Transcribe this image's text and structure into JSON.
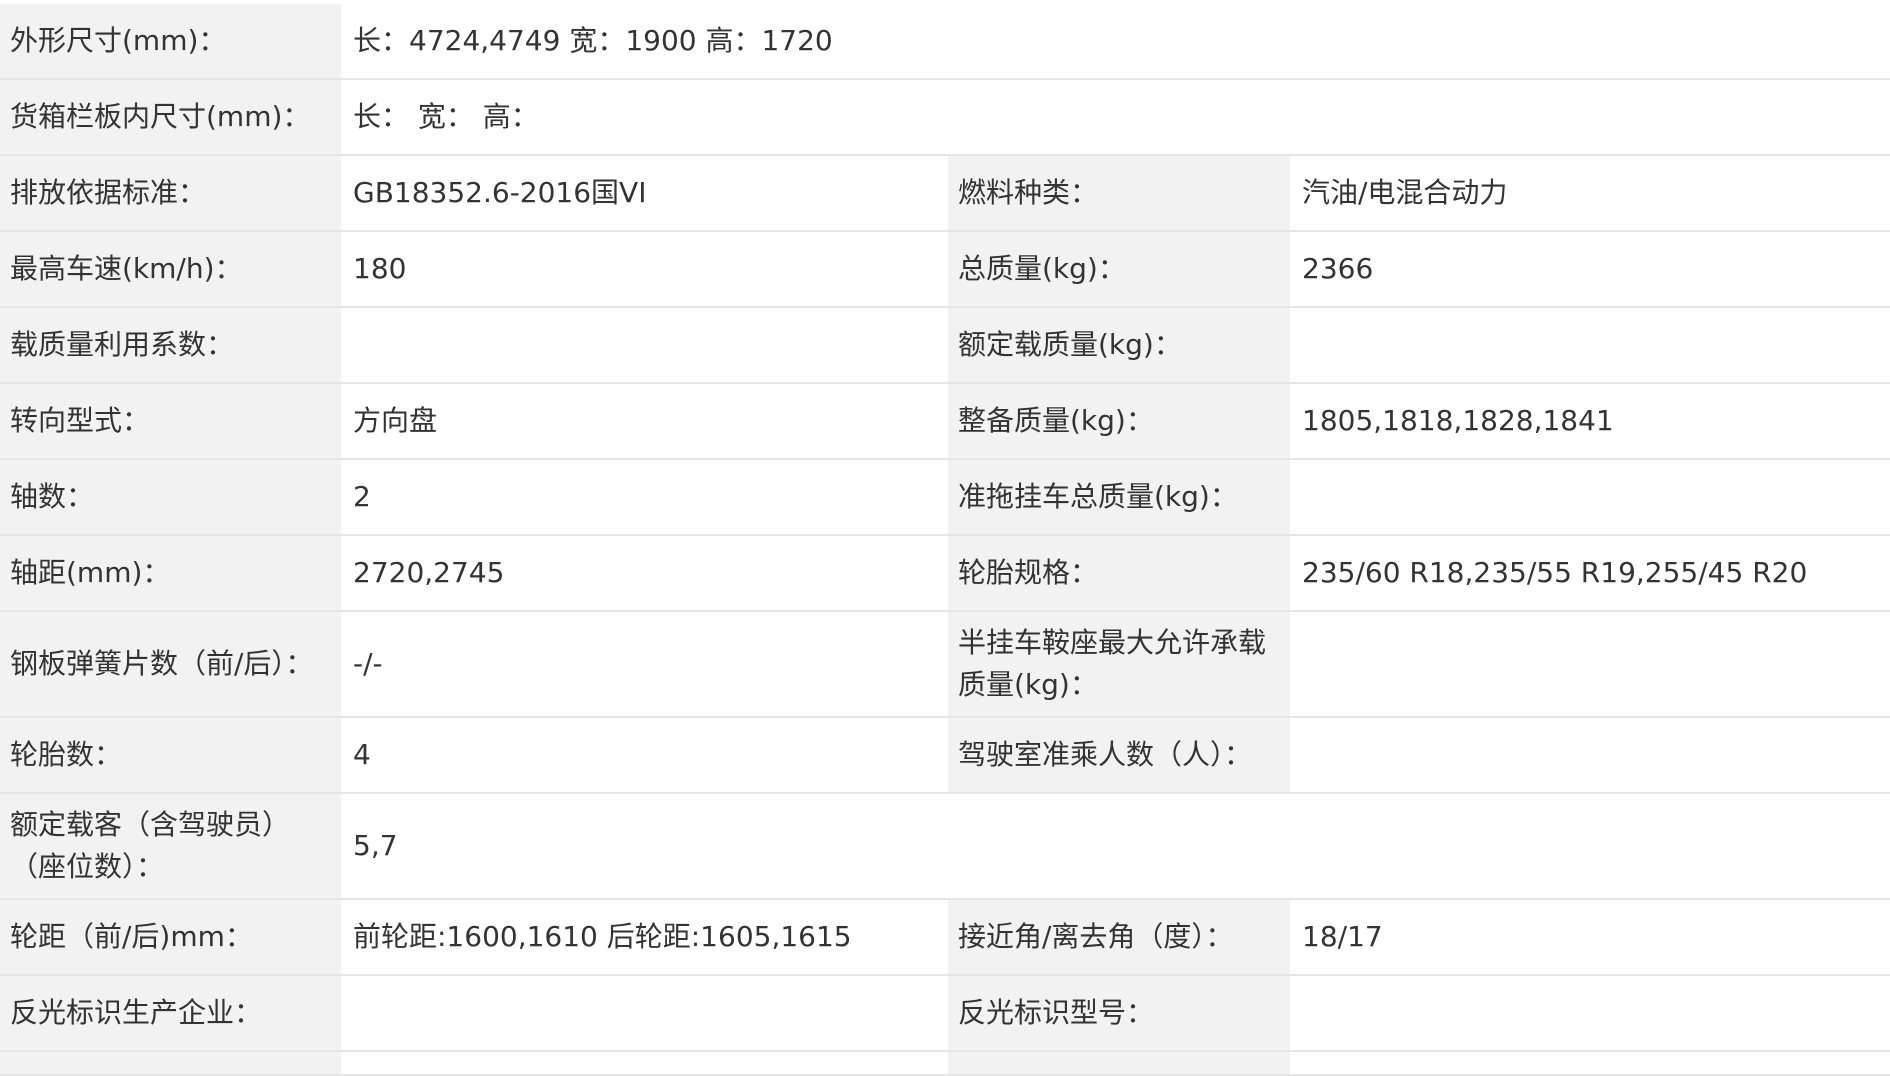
{
  "rows": [
    {
      "label1": "外形尺寸(mm)：",
      "value1": "长：4724,4749 宽：1900 高：1720"
    },
    {
      "label1": "货箱栏板内尺寸(mm)：",
      "value1": "长： 宽： 高："
    },
    {
      "label1": "排放依据标准：",
      "value1": "GB18352.6-2016国VI",
      "label2": "燃料种类：",
      "value2": "汽油/电混合动力"
    },
    {
      "label1": "最高车速(km/h)：",
      "value1": "180",
      "label2": "总质量(kg)：",
      "value2": "2366"
    },
    {
      "label1": "载质量利用系数：",
      "value1": "",
      "label2": "额定载质量(kg)：",
      "value2": ""
    },
    {
      "label1": "转向型式：",
      "value1": "方向盘",
      "label2": "整备质量(kg)：",
      "value2": "1805,1818,1828,1841"
    },
    {
      "label1": "轴数：",
      "value1": "2",
      "label2": "准拖挂车总质量(kg)：",
      "value2": ""
    },
    {
      "label1": "轴距(mm)：",
      "value1": "2720,2745",
      "label2": "轮胎规格：",
      "value2": "235/60 R18,235/55 R19,255/45 R20"
    },
    {
      "label1": "钢板弹簧片数（前/后）：",
      "value1": "-/-",
      "label2": "半挂车鞍座最大允许承载质量(kg)：",
      "value2": ""
    },
    {
      "label1": "轮胎数：",
      "value1": "4",
      "label2": "驾驶室准乘人数（人）：",
      "value2": ""
    },
    {
      "label1": "额定载客（含驾驶员）（座位数）：",
      "value1": "5,7"
    },
    {
      "label1": "轮距（前/后)mm：",
      "value1": "前轮距:1600,1610 后轮距:1605,1615",
      "label2": "接近角/离去角（度）：",
      "value2": "18/17"
    },
    {
      "label1": "反光标识生产企业：",
      "value1": "",
      "label2": "反光标识型号：",
      "value2": ""
    }
  ]
}
